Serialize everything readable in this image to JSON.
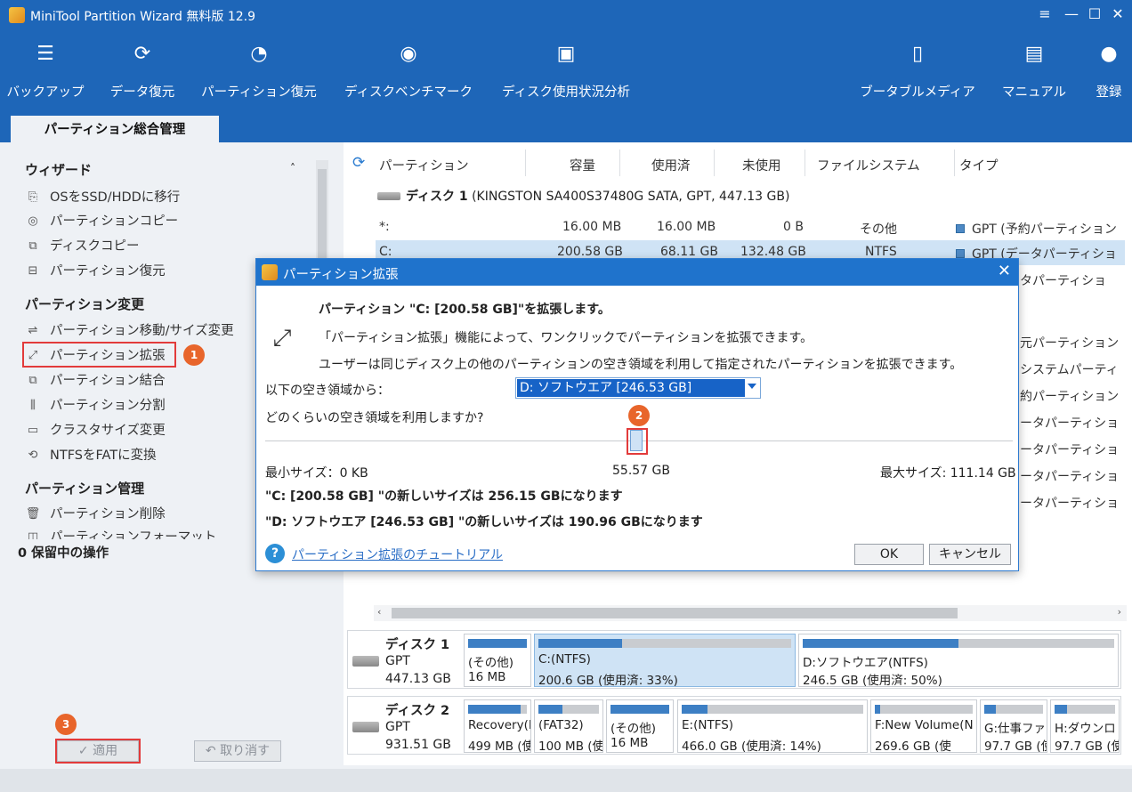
{
  "app": {
    "title": "MiniTool Partition Wizard 無料版 12.9"
  },
  "toolbar": [
    {
      "label": "バックアップ",
      "icon": "backup-icon"
    },
    {
      "label": "データ復元",
      "icon": "data-recovery-icon"
    },
    {
      "label": "パーティション復元",
      "icon": "partition-recovery-icon"
    },
    {
      "label": "ディスクベンチマーク",
      "icon": "disk-benchmark-icon"
    },
    {
      "label": "ディスク使用状況分析",
      "icon": "disk-usage-icon"
    },
    {
      "label": "ブータブルメディア",
      "icon": "bootable-media-icon"
    },
    {
      "label": "マニュアル",
      "icon": "manual-icon"
    },
    {
      "label": "登録",
      "icon": "register-icon"
    }
  ],
  "tab": {
    "label": "パーティション総合管理"
  },
  "sidebar": {
    "wizard": {
      "title": "ウィザード",
      "items": [
        "OSをSSD/HDDに移行",
        "パーティションコピー",
        "ディスクコピー",
        "パーティション復元"
      ]
    },
    "change": {
      "title": "パーティション変更",
      "items": [
        "パーティション移動/サイズ変更",
        "パーティション拡張",
        "パーティション結合",
        "パーティション分割",
        "クラスタサイズ変更",
        "NTFSをFATに変換"
      ]
    },
    "manage": {
      "title": "パーティション管理",
      "items": [
        "パーティション削除",
        "パーティションフォーマット"
      ]
    },
    "pending": "0 保留中の操作",
    "apply_label": "✓ 適用",
    "undo_label": "↶ 取り消す",
    "badges": [
      "1",
      "2",
      "3"
    ]
  },
  "table": {
    "headers": [
      "パーティション",
      "容量",
      "使用済",
      "未使用",
      "ファイルシステム",
      "タイプ"
    ],
    "disk1_label": "ディスク 1",
    "disk1_desc": "(KINGSTON SA400S37480G SATA, GPT, 447.13 GB)",
    "rows": [
      {
        "name": "*:",
        "cap": "16.00 MB",
        "used": "16.00 MB",
        "free": "0 B",
        "fs": "その他",
        "type": "GPT (予約パーティション"
      },
      {
        "name": "C:",
        "cap": "200.58 GB",
        "used": "68.11 GB",
        "free": "132.48 GB",
        "fs": "NTFS",
        "type": "GPT (データパーティショ"
      }
    ],
    "partial_types": [
      "タパーティショ",
      "元パーティション",
      "システムパーティ",
      "約パーティション",
      "ータパーティショ",
      "ータパーティショ",
      "ータパーティショ",
      "ータパーティショ"
    ]
  },
  "disks": [
    {
      "name": "ディスク 1",
      "type": "GPT",
      "size": "447.13 GB",
      "parts": [
        {
          "n": "(その他)",
          "s": "16 MB",
          "pct": 100
        },
        {
          "n": "C:(NTFS)",
          "s": "200.6 GB (使用済: 33%)",
          "pct": 33
        },
        {
          "n": "D:ソフトウエア(NTFS)",
          "s": "246.5 GB (使用済: 50%)",
          "pct": 50
        }
      ]
    },
    {
      "name": "ディスク 2",
      "type": "GPT",
      "size": "931.51 GB",
      "parts": [
        {
          "n": "Recovery(N",
          "s": "499 MB (使",
          "pct": 90
        },
        {
          "n": "(FAT32)",
          "s": "100 MB (使",
          "pct": 40
        },
        {
          "n": "(その他)",
          "s": "16 MB",
          "pct": 100
        },
        {
          "n": "E:(NTFS)",
          "s": "466.0 GB (使用済: 14%)",
          "pct": 14
        },
        {
          "n": "F:New Volume(N",
          "s": "269.6 GB (使",
          "pct": 5
        },
        {
          "n": "G:仕事ファ",
          "s": "97.7 GB (使",
          "pct": 20
        },
        {
          "n": "H:ダウンロ",
          "s": "97.7 GB (使",
          "pct": 20
        }
      ]
    }
  ],
  "dialog": {
    "title": "パーティション拡張",
    "heading": "パーティション \"C: [200.58 GB]\"を拡張します。",
    "desc1": "「パーティション拡張」機能によって、ワンクリックでパーティションを拡張できます。",
    "desc2": "ユーザーは同じディスク上の他のパーティションの空き領域を利用して指定されたパーティションを拡張できます。",
    "from_label": "以下の空き領域から：",
    "from_value": "D: ソフトウエア [246.53 GB]",
    "how_much": "どのくらいの空き領域を利用しますか?",
    "min": "最小サイズ：0 KB",
    "mid": "55.57 GB",
    "max": "最大サイズ: 111.14 GB",
    "c_new": "\"C: [200.58 GB] \"の新しいサイズは 256.15 GBになります",
    "d_new": "\"D: ソフトウエア [246.53 GB] \"の新しいサイズは 190.96 GBになります",
    "help_link": "パーティション拡張のチュートリアル",
    "ok": "OK",
    "cancel": "キャンセル",
    "slider_fraction": 0.5
  }
}
